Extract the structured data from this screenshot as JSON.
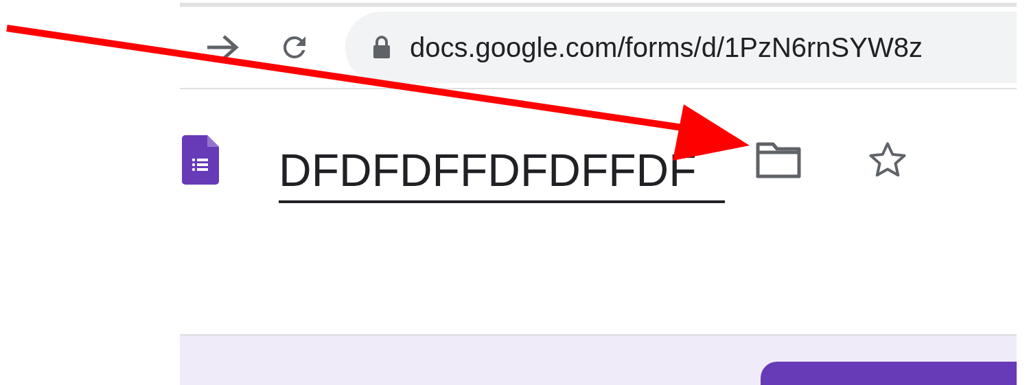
{
  "browser": {
    "url": "docs.google.com/forms/d/1PzN6rnSYW8z"
  },
  "form": {
    "title": "DFDFDFFDFDFFDF"
  }
}
